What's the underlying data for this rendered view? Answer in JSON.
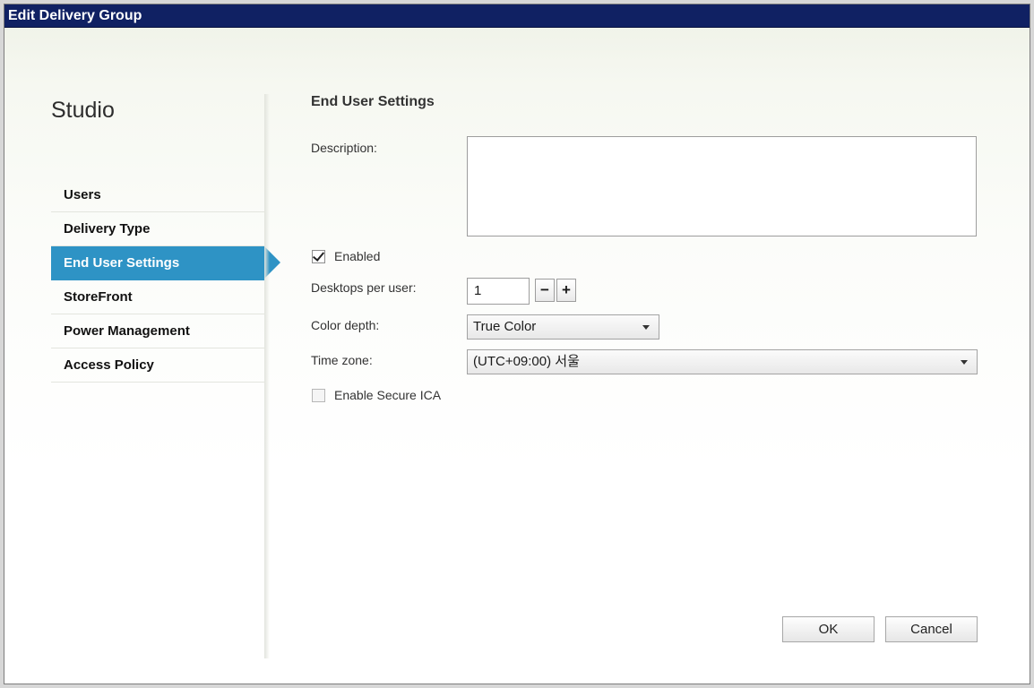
{
  "window": {
    "title": "Edit Delivery Group"
  },
  "sidebar": {
    "heading": "Studio",
    "items": [
      {
        "label": "Users"
      },
      {
        "label": "Delivery Type"
      },
      {
        "label": "End User Settings",
        "active": true
      },
      {
        "label": "StoreFront"
      },
      {
        "label": "Power Management"
      },
      {
        "label": "Access Policy"
      }
    ]
  },
  "main": {
    "title": "End User Settings",
    "description": {
      "label": "Description:",
      "value": ""
    },
    "enabled": {
      "label": "Enabled",
      "checked": true
    },
    "desktops": {
      "label": "Desktops per user:",
      "value": "1",
      "minus": "−",
      "plus": "+"
    },
    "color_depth": {
      "label": "Color depth:",
      "value": "True Color"
    },
    "time_zone": {
      "label": "Time zone:",
      "value": "(UTC+09:00) 서울"
    },
    "secure_ica": {
      "label": "Enable Secure ICA",
      "checked": false
    }
  },
  "footer": {
    "ok": "OK",
    "cancel": "Cancel"
  },
  "colors": {
    "titlebar": "#102163",
    "accent": "#2e93c5"
  }
}
